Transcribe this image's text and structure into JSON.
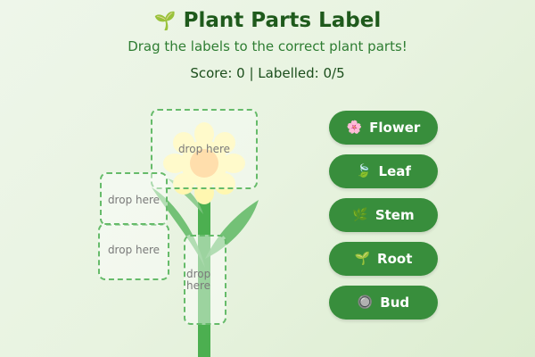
{
  "header": {
    "title_icon": "🌱",
    "title": "Plant Parts Label",
    "subtitle": "Drag the labels to the correct plant parts!",
    "score": "Score: 0 | Labelled: 0/5"
  },
  "dropzones": {
    "flower": "drop here",
    "leaf_upper": "drop here",
    "leaf_lower": "drop here",
    "stem": "drop here"
  },
  "labels": [
    {
      "icon": "🌸",
      "icon_name": "cherry-blossom-icon",
      "text": "Flower"
    },
    {
      "icon": "🍃",
      "icon_name": "leaf-icon",
      "text": "Leaf"
    },
    {
      "icon": "🌿",
      "icon_name": "herb-icon",
      "text": "Stem"
    },
    {
      "icon": "🌱",
      "icon_name": "seedling-icon",
      "text": "Root"
    },
    {
      "icon": "🔘",
      "icon_name": "radio-button-icon",
      "text": "Bud"
    }
  ],
  "colors": {
    "button": "#388e3c",
    "stem": "#4caf50",
    "petal": "#fff7b0",
    "center": "#ffcc80",
    "dropzone_border": "#66bb6a"
  }
}
